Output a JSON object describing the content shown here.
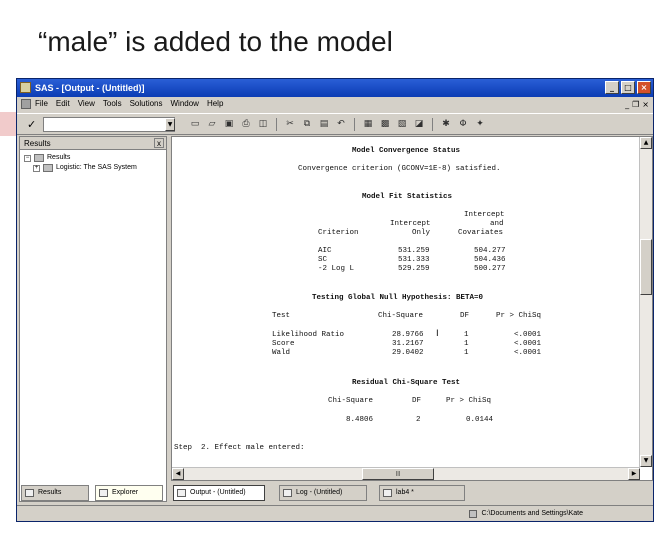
{
  "slide": {
    "title": "“male” is added to the model"
  },
  "window": {
    "title": "SAS - [Output - (Untitled)]",
    "menu": [
      "File",
      "Edit",
      "View",
      "Tools",
      "Solutions",
      "Window",
      "Help"
    ]
  },
  "results": {
    "header": "Results",
    "close": "x",
    "tree": [
      {
        "expander": "−",
        "label": "Results"
      },
      {
        "expander": "+",
        "label": "Logistic: The SAS System"
      }
    ]
  },
  "output": {
    "convergence": {
      "heading": "Model Convergence Status",
      "text": "Convergence criterion (GCONV=1E-8) satisfied."
    },
    "fit": {
      "heading": "Model Fit Statistics",
      "col_intercept_only": [
        "Intercept",
        "Only"
      ],
      "col_covariates": [
        "Intercept",
        "and",
        "Covariates"
      ],
      "col_criterion": "Criterion",
      "rows": [
        {
          "criterion": "AIC",
          "only": "531.259",
          "cov": "504.277"
        },
        {
          "criterion": "SC",
          "only": "531.333",
          "cov": "504.436"
        },
        {
          "criterion": "-2 Log L",
          "only": "529.259",
          "cov": "500.277"
        }
      ]
    },
    "global": {
      "heading": "Testing Global Null Hypothesis: BETA=0",
      "headers": [
        "Test",
        "Chi-Square",
        "DF",
        "Pr > ChiSq"
      ],
      "rows": [
        {
          "test": "Likelihood Ratio",
          "chi": "28.9766",
          "df": "1",
          "p": "<.0001"
        },
        {
          "test": "Score",
          "chi": "31.2167",
          "df": "1",
          "p": "<.0001"
        },
        {
          "test": "Wald",
          "chi": "29.0402",
          "df": "1",
          "p": "<.0001"
        }
      ]
    },
    "residual": {
      "heading": "Residual Chi-Square Test",
      "headers": [
        "Chi-Square",
        "DF",
        "Pr > ChiSq"
      ],
      "chi": "8.4806",
      "df": "2",
      "p": "0.0144"
    },
    "step": "Step  2. Effect male entered:"
  },
  "left_tabs": [
    {
      "label": "Results"
    },
    {
      "label": "Explorer"
    }
  ],
  "tasks": [
    {
      "label": "Output - (Untitled)"
    },
    {
      "label": "Log - (Untitled)"
    },
    {
      "label": "lab4 *"
    }
  ],
  "status": {
    "path": "C:\\Documents and Settings\\Kate"
  },
  "colors": {
    "titlebar": "#0b3cb4",
    "window_bg": "#d4d0c8"
  }
}
